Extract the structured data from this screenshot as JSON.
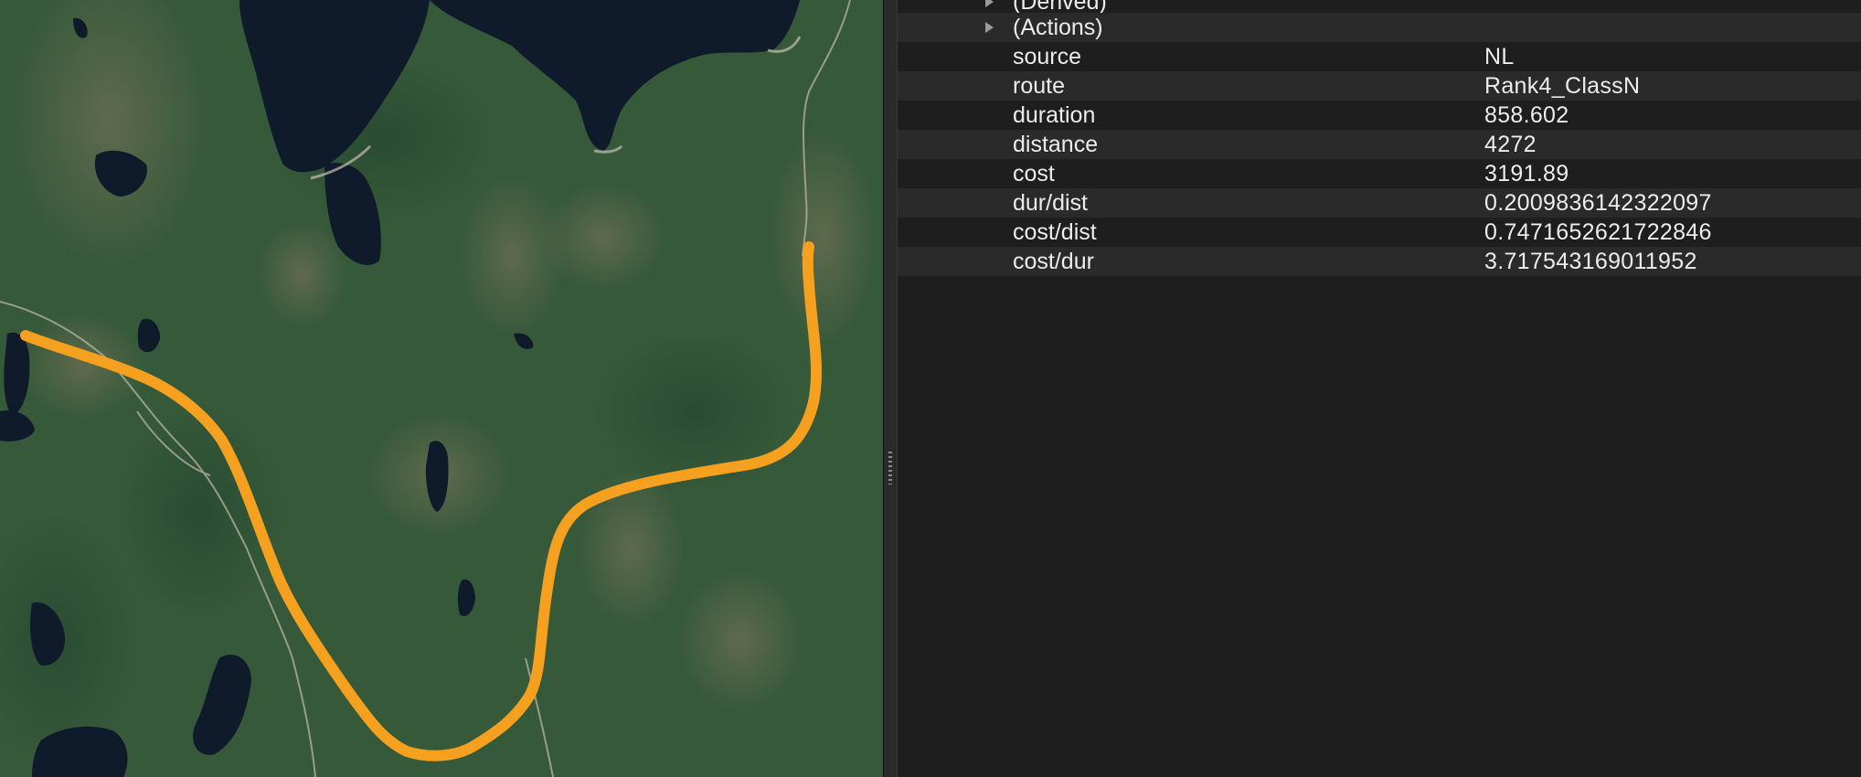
{
  "map": {
    "base_color": "#36593a",
    "water_color": "#0f1a2a",
    "route_color": "#f5a01e"
  },
  "inspector": {
    "groups": [
      {
        "label": "(Derived)"
      },
      {
        "label": "(Actions)"
      }
    ],
    "rows": [
      {
        "key": "source",
        "value": "NL"
      },
      {
        "key": "route",
        "value": "Rank4_ClassN"
      },
      {
        "key": "duration",
        "value": "858.602"
      },
      {
        "key": "distance",
        "value": "4272"
      },
      {
        "key": "cost",
        "value": "3191.89"
      },
      {
        "key": "dur/dist",
        "value": "0.2009836142322097"
      },
      {
        "key": "cost/dist",
        "value": "0.7471652621722846"
      },
      {
        "key": "cost/dur",
        "value": "3.717543169011952"
      }
    ]
  }
}
